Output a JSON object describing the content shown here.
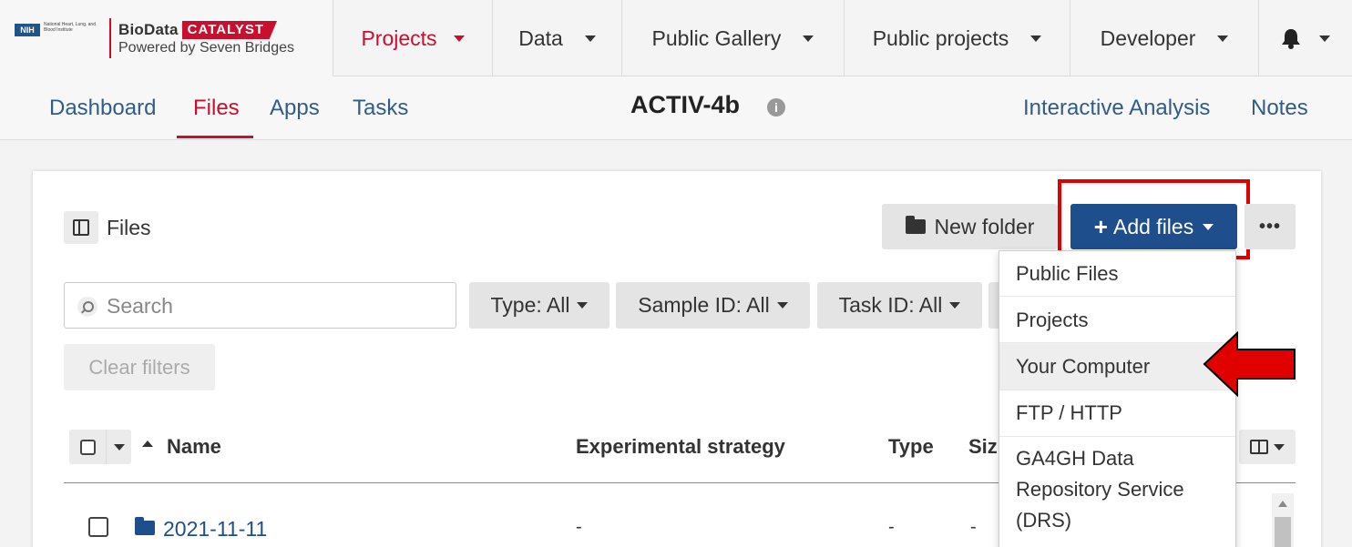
{
  "brand": {
    "nih_badge": "NIH",
    "nih_institute": "National Heart, Lung, and Blood Institute",
    "bio": "BioData",
    "catalyst": "CATALYST",
    "powered": "Powered by Seven Bridges"
  },
  "topnav": {
    "items": [
      {
        "label": "Projects"
      },
      {
        "label": "Data"
      },
      {
        "label": "Public Gallery"
      },
      {
        "label": "Public projects"
      },
      {
        "label": "Developer"
      }
    ],
    "bell_icon": "bell-icon"
  },
  "subnav": {
    "tabs": [
      {
        "label": "Dashboard"
      },
      {
        "label": "Files"
      },
      {
        "label": "Apps"
      },
      {
        "label": "Tasks"
      }
    ],
    "project_title": "ACTIV-4b",
    "right_links": [
      {
        "label": "Interactive Analysis"
      },
      {
        "label": "Notes"
      }
    ]
  },
  "files_panel": {
    "title": "Files",
    "new_folder": "New folder",
    "add_files": "Add files",
    "more": "•••",
    "search_placeholder": "Search",
    "filters": [
      {
        "label": "Type: All"
      },
      {
        "label": "Sample ID: All"
      },
      {
        "label": "Task ID: All"
      }
    ],
    "clear_filters": "Clear filters",
    "columns": {
      "name": "Name",
      "experimental_strategy": "Experimental strategy",
      "type": "Type",
      "size": "Siz"
    },
    "rows": [
      {
        "name": "2021-11-11",
        "experimental_strategy": "-",
        "type": "-",
        "size": "-"
      }
    ]
  },
  "add_files_menu": {
    "items": [
      {
        "label": "Public Files"
      },
      {
        "label": "Projects"
      },
      {
        "label": "Your Computer"
      },
      {
        "label": "FTP / HTTP"
      },
      {
        "label": "GA4GH Data Repository Service (DRS)"
      }
    ]
  },
  "colors": {
    "accent_red": "#c8102e",
    "primary_blue": "#1f4e8c",
    "annotation_red": "#e00000"
  }
}
